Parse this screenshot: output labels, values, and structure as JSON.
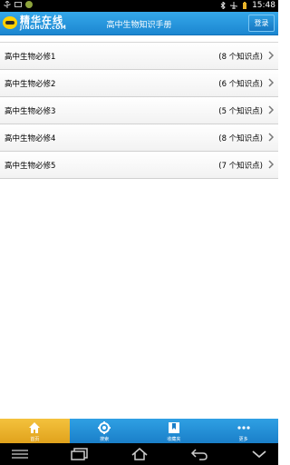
{
  "status_bar": {
    "time": "15:48"
  },
  "app_bar": {
    "brand_cn": "精华在线",
    "brand_en": "JINGHUA.cOM",
    "title": "高中生物知识手册",
    "login_label": "登录"
  },
  "list": [
    {
      "name": "高中生物必修1",
      "count": "(8 个知识点)"
    },
    {
      "name": "高中生物必修2",
      "count": "(6 个知识点)"
    },
    {
      "name": "高中生物必修3",
      "count": "(5 个知识点)"
    },
    {
      "name": "高中生物必修4",
      "count": "(8 个知识点)"
    },
    {
      "name": "高中生物必修5",
      "count": "(7 个知识点)"
    }
  ],
  "tabs": [
    {
      "label": "首页",
      "icon": "home-icon",
      "active": true
    },
    {
      "label": "搜索",
      "icon": "gear-icon",
      "active": false
    },
    {
      "label": "收藏夹",
      "icon": "bookmark-icon",
      "active": false
    },
    {
      "label": "更多",
      "icon": "more-icon",
      "active": false
    }
  ],
  "colors": {
    "accent": "#1b86d0",
    "active_tab": "#e8ad28"
  }
}
